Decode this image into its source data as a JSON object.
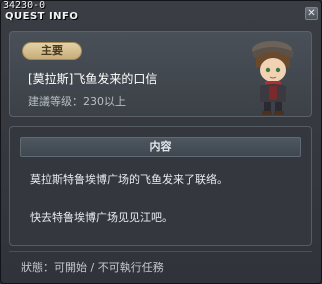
{
  "window": {
    "quest_id": "34230-0",
    "title": "QUEST INFO"
  },
  "quest": {
    "category_badge": "主要",
    "name": "[莫拉斯]飞鱼发来的口信",
    "level_requirement": "建議等级：230以上"
  },
  "content": {
    "header": "内容",
    "lines": [
      "莫拉斯特鲁埃博广场的飞鱼发来了联络。",
      "快去特鲁埃博广场见见江吧。"
    ]
  },
  "status": {
    "text": "狀態：可開始 / 不可執行任務"
  },
  "icons": {
    "close": "close-icon",
    "npc": "npc-portrait-icon"
  },
  "colors": {
    "badge": "#d4bd8c",
    "background": "#2a2e33"
  }
}
